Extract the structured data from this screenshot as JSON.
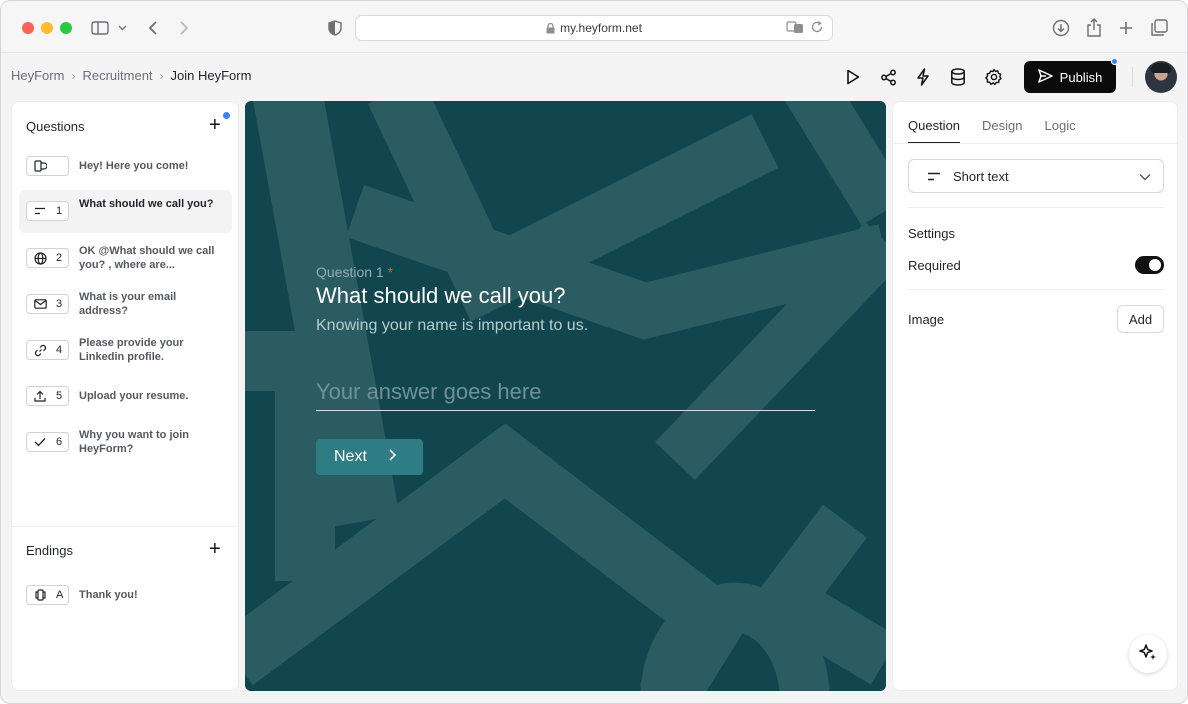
{
  "browser": {
    "url": "my.heyform.net"
  },
  "breadcrumb": {
    "items": [
      "HeyForm",
      "Recruitment",
      "Join HeyForm"
    ],
    "separator": "›"
  },
  "toolbar": {
    "publish_label": "Publish"
  },
  "questions_panel": {
    "title": "Questions",
    "items": [
      {
        "number": "",
        "icon": "welcome-icon",
        "text": "Hey! Here you come!"
      },
      {
        "number": "1",
        "icon": "short-text-icon",
        "text": "What should we call you?"
      },
      {
        "number": "2",
        "icon": "globe-icon",
        "text": "OK @What should we call you? , where are..."
      },
      {
        "number": "3",
        "icon": "mail-icon",
        "text": "What is your email address?"
      },
      {
        "number": "4",
        "icon": "link-icon",
        "text": "Please provide your Linkedin profile."
      },
      {
        "number": "5",
        "icon": "upload-icon",
        "text": "Upload your resume."
      },
      {
        "number": "6",
        "icon": "check-icon",
        "text": "Why you want to join HeyForm?"
      }
    ]
  },
  "endings_panel": {
    "title": "Endings",
    "items": [
      {
        "number": "A",
        "icon": "ending-icon",
        "text": "Thank you!"
      }
    ]
  },
  "canvas": {
    "question_label": "Question 1",
    "required_mark": "*",
    "title": "What should we call you?",
    "description": "Knowing your name is important to us.",
    "answer_placeholder": "Your answer goes here",
    "next_label": "Next",
    "background_color": "#11464e",
    "button_color": "#2f7d84"
  },
  "settings_panel": {
    "tabs": [
      "Question",
      "Design",
      "Logic"
    ],
    "active_tab": "Question",
    "type_select": "Short text",
    "settings_title": "Settings",
    "required_label": "Required",
    "required_on": true,
    "image_label": "Image",
    "image_add_label": "Add"
  }
}
